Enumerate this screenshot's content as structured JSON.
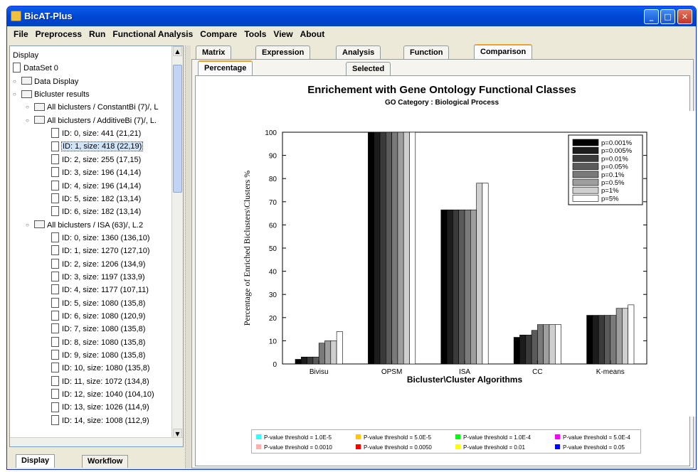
{
  "window": {
    "title": "BicAT-Plus"
  },
  "menu": [
    "File",
    "Preprocess",
    "Run",
    "Functional Analysis",
    "Compare",
    "Tools",
    "View",
    "About"
  ],
  "tree": [
    {
      "label": "Display",
      "indent": 0,
      "kind": "text",
      "toggle": ""
    },
    {
      "label": "DataSet 0",
      "indent": 0,
      "kind": "doc",
      "toggle": ""
    },
    {
      "label": "Data Display",
      "indent": 1,
      "kind": "folder",
      "toggle": "►"
    },
    {
      "label": "Bicluster results",
      "indent": 1,
      "kind": "folder",
      "toggle": "▼"
    },
    {
      "label": "All biclusters / ConstantBi (7)/, L",
      "indent": 2,
      "kind": "folder",
      "toggle": "►"
    },
    {
      "label": "All biclusters / AdditiveBi (7)/, L.",
      "indent": 2,
      "kind": "folder",
      "toggle": "▼"
    },
    {
      "label": "ID: 0, size: 441 (21,21)",
      "indent": 3,
      "kind": "doc",
      "toggle": ""
    },
    {
      "label": "ID: 1, size: 418 (22,19)",
      "indent": 3,
      "kind": "doc",
      "toggle": "",
      "selected": true
    },
    {
      "label": "ID: 2, size: 255 (17,15)",
      "indent": 3,
      "kind": "doc",
      "toggle": ""
    },
    {
      "label": "ID: 3, size: 196 (14,14)",
      "indent": 3,
      "kind": "doc",
      "toggle": ""
    },
    {
      "label": "ID: 4, size: 196 (14,14)",
      "indent": 3,
      "kind": "doc",
      "toggle": ""
    },
    {
      "label": "ID: 5, size: 182 (13,14)",
      "indent": 3,
      "kind": "doc",
      "toggle": ""
    },
    {
      "label": "ID: 6, size: 182 (13,14)",
      "indent": 3,
      "kind": "doc",
      "toggle": ""
    },
    {
      "label": "All biclusters / ISA (63)/, L.2",
      "indent": 2,
      "kind": "folder",
      "toggle": "▼"
    },
    {
      "label": "ID: 0, size: 1360 (136,10)",
      "indent": 3,
      "kind": "doc",
      "toggle": ""
    },
    {
      "label": "ID: 1, size: 1270 (127,10)",
      "indent": 3,
      "kind": "doc",
      "toggle": ""
    },
    {
      "label": "ID: 2, size: 1206 (134,9)",
      "indent": 3,
      "kind": "doc",
      "toggle": ""
    },
    {
      "label": "ID: 3, size: 1197 (133,9)",
      "indent": 3,
      "kind": "doc",
      "toggle": ""
    },
    {
      "label": "ID: 4, size: 1177 (107,11)",
      "indent": 3,
      "kind": "doc",
      "toggle": ""
    },
    {
      "label": "ID: 5, size: 1080 (135,8)",
      "indent": 3,
      "kind": "doc",
      "toggle": ""
    },
    {
      "label": "ID: 6, size: 1080 (120,9)",
      "indent": 3,
      "kind": "doc",
      "toggle": ""
    },
    {
      "label": "ID: 7, size: 1080 (135,8)",
      "indent": 3,
      "kind": "doc",
      "toggle": ""
    },
    {
      "label": "ID: 8, size: 1080 (135,8)",
      "indent": 3,
      "kind": "doc",
      "toggle": ""
    },
    {
      "label": "ID: 9, size: 1080 (135,8)",
      "indent": 3,
      "kind": "doc",
      "toggle": ""
    },
    {
      "label": "ID: 10, size: 1080 (135,8)",
      "indent": 3,
      "kind": "doc",
      "toggle": ""
    },
    {
      "label": "ID: 11, size: 1072 (134,8)",
      "indent": 3,
      "kind": "doc",
      "toggle": ""
    },
    {
      "label": "ID: 12, size: 1040 (104,10)",
      "indent": 3,
      "kind": "doc",
      "toggle": ""
    },
    {
      "label": "ID: 13, size: 1026 (114,9)",
      "indent": 3,
      "kind": "doc",
      "toggle": ""
    },
    {
      "label": "ID: 14, size: 1008 (112,9)",
      "indent": 3,
      "kind": "doc",
      "toggle": ""
    }
  ],
  "left_tabs": [
    "Display view",
    "Workflow"
  ],
  "main_tabs": [
    "Matrix view",
    "Expression view",
    "Analysis view",
    "Function view",
    "Comparison view"
  ],
  "main_active": 4,
  "sub_tabs": [
    "Percentage of Enriched Biclusters",
    "Selected Patterns"
  ],
  "sub_active": 0,
  "chart_header": {
    "title": "Enrichement with Gene Ontology Functional Classes",
    "subtitle": "GO Category :  Biological Process"
  },
  "chart_data": {
    "type": "bar",
    "xlabel": "Bicluster\\Cluster Algorithms",
    "ylabel": "Percentage of Enriched Biclusters\\Clusters %",
    "ylim": [
      0,
      100
    ],
    "yticks": [
      0,
      10,
      20,
      30,
      40,
      50,
      60,
      70,
      80,
      90,
      100
    ],
    "categories": [
      "Bivisu",
      "OPSM",
      "ISA",
      "CC",
      "K-means"
    ],
    "legend_position": "top-right",
    "series": [
      {
        "name": "p=0.001%",
        "color": "#000000",
        "values": [
          2,
          100,
          66.5,
          11.5,
          21
        ]
      },
      {
        "name": "p=0.005%",
        "color": "#1c1c1c",
        "values": [
          3,
          100,
          66.5,
          12.5,
          21
        ]
      },
      {
        "name": "p=0.01%",
        "color": "#3a3a3a",
        "values": [
          3,
          100,
          66.5,
          12.5,
          21
        ]
      },
      {
        "name": "p=0.05%",
        "color": "#5a5a5a",
        "values": [
          3,
          100,
          66.5,
          14.5,
          21
        ]
      },
      {
        "name": "p=0.1%",
        "color": "#7a7a7a",
        "values": [
          9,
          100,
          66.5,
          17,
          21
        ]
      },
      {
        "name": "p=0.5%",
        "color": "#9e9e9e",
        "values": [
          10,
          100,
          66.5,
          17,
          24
        ]
      },
      {
        "name": "p=1%",
        "color": "#cfcfcf",
        "values": [
          10,
          100,
          78,
          17,
          24
        ]
      },
      {
        "name": "p=5%",
        "color": "#ffffff",
        "values": [
          14,
          100,
          78,
          17,
          25.5
        ]
      }
    ]
  },
  "threshold_legend": [
    {
      "label": "P-value threshold = 1.0E-5",
      "color": "#33ffff"
    },
    {
      "label": "P-value threshold = 5.0E-5",
      "color": "#ffc800"
    },
    {
      "label": "P-value threshold = 1.0E-4",
      "color": "#00ff00"
    },
    {
      "label": "P-value threshold = 5.0E-4",
      "color": "#ff00ff"
    },
    {
      "label": "P-value threshold = 0.0010",
      "color": "#ffafaf"
    },
    {
      "label": "P-value threshold = 0.0050",
      "color": "#ff0000"
    },
    {
      "label": "P-value threshold = 0.01",
      "color": "#ffff00"
    },
    {
      "label": "P-value threshold = 0.05",
      "color": "#0000ff"
    }
  ]
}
